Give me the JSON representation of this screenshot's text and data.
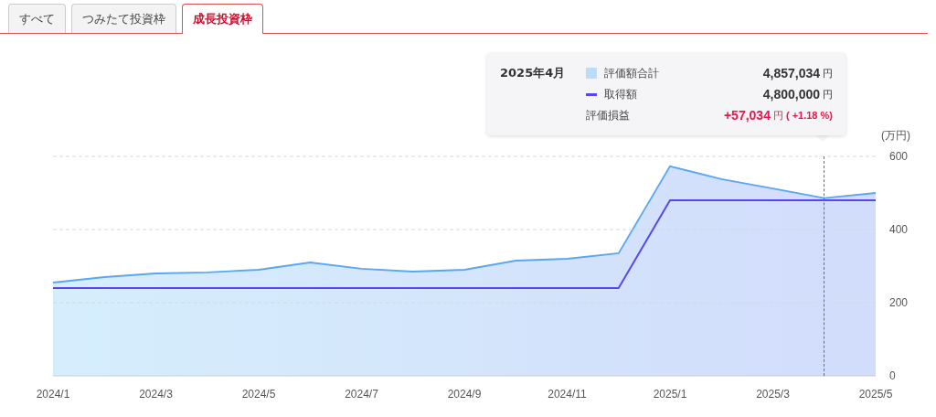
{
  "tabs": [
    {
      "label": "すべて",
      "selected": false
    },
    {
      "label": "つみたて投資枠",
      "selected": false
    },
    {
      "label": "成長投資枠",
      "selected": true
    }
  ],
  "tooltip": {
    "month": "2025年4月",
    "rows": [
      {
        "kind": "area",
        "label": "評価額合計",
        "value": "4,857,034",
        "unit": "円"
      },
      {
        "kind": "line",
        "label": "取得額",
        "value": "4,800,000",
        "unit": "円"
      },
      {
        "kind": "gain",
        "label": "評価損益",
        "value": "+57,034",
        "unit": "円",
        "percent": "( +1.18 %)"
      }
    ]
  },
  "chart": {
    "unit": "(万円)",
    "chart_data": {
      "type": "area",
      "categories": [
        "2024/1",
        null,
        "2024/3",
        null,
        "2024/5",
        null,
        "2024/7",
        null,
        "2024/9",
        null,
        "2024/11",
        null,
        "2025/1",
        null,
        "2025/3",
        null,
        "2025/5"
      ],
      "ylim": [
        0,
        600
      ],
      "yticks": [
        0,
        200,
        400,
        600
      ],
      "series": [
        {
          "type": "area",
          "color": "#5aa6f5",
          "values": [
            255,
            270,
            280,
            283,
            290,
            310,
            293,
            285,
            290,
            315,
            320,
            335,
            573,
            538,
            512,
            486,
            500
          ]
        },
        {
          "type": "line",
          "color": "#5b45ef",
          "values": [
            240,
            240,
            240,
            240,
            240,
            240,
            240,
            240,
            240,
            240,
            240,
            240,
            480,
            480,
            480,
            480,
            480
          ]
        }
      ]
    }
  }
}
